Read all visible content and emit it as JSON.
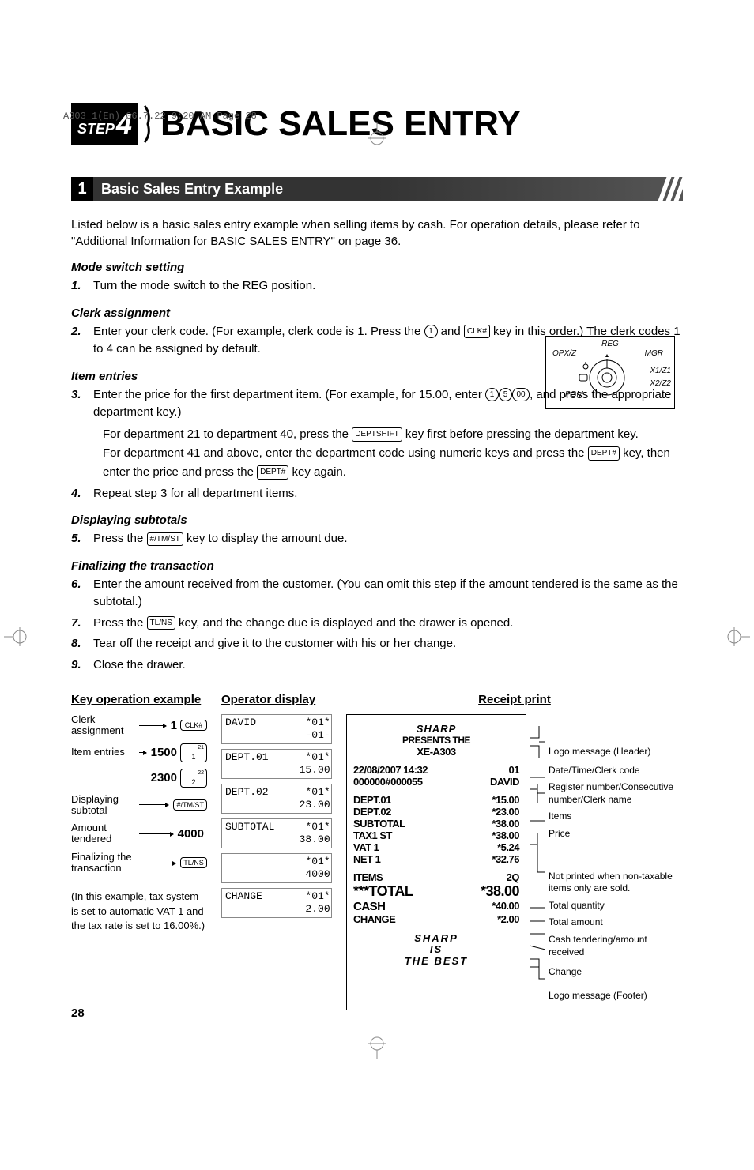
{
  "print_header": "A303_1(En)  06.7.22 9:20 AM  Page 28",
  "step_label": "STEP",
  "step_num": "4",
  "main_title": "BASIC SALES ENTRY",
  "section_num": "1",
  "section_title": "Basic Sales Entry Example",
  "intro": "Listed below is a basic sales entry example when selling items by cash.  For operation details, please refer to \"Additional Information for BASIC SALES ENTRY\" on page 36.",
  "mode_h": "Mode switch setting",
  "mode_step": "Turn the mode switch to the REG position.",
  "clerk_h": "Clerk assignment",
  "clerk_step_a": "Enter your clerk code. (For example, clerk code is 1.  Press the ",
  "clerk_step_b": " and ",
  "clerk_step_c": " key in this order.)  The clerk codes 1 to 4 can be assigned by default.",
  "clerk_key1": "1",
  "clerk_key2": "CLK#",
  "item_h": "Item entries",
  "item_step3_a": "Enter the price for the first department item. (For example, for 15.00, enter ",
  "item_step3_b": ", and press the appropriate department key.)",
  "k1": "1",
  "k5": "5",
  "k00": "00",
  "item_sub1_a": "For department 21 to department 40, press the ",
  "item_sub1_b": " key first before pressing the department key.",
  "item_sub1_key": "DEPTSHIFT",
  "item_sub2_a": "For department 41 and above, enter the department code using numeric keys and press the ",
  "item_sub2_b": " key, then enter the price and press the ",
  "item_sub2_c": " key again.",
  "item_sub2_key": "DEPT#",
  "item_step4": "Repeat step 3 for all department items.",
  "disp_h": "Displaying subtotals",
  "disp_step_a": "Press the ",
  "disp_step_b": " key to display the amount due.",
  "disp_key": "#/TM/ST",
  "fin_h": "Finalizing the transaction",
  "fin_step6": "Enter the amount received from the customer.  (You can omit this step if the amount tendered is the same as the subtotal.)",
  "fin_step7_a": "Press the ",
  "fin_step7_b": " key, and the change due is displayed and the drawer is opened.",
  "fin_key": "TL/NS",
  "fin_step8": "Tear off the receipt and give it to the customer with his or her change.",
  "fin_step9": "Close the drawer.",
  "dial": {
    "reg": "REG",
    "opxz": "OPX/Z",
    "mgr": "MGR",
    "x1z1": "X1/Z1",
    "x2z2": "X2/Z2",
    "pgm": "PGM"
  },
  "col1_h": "Key operation example",
  "col2_h": "Operator display",
  "col3_h": "Receipt print",
  "kop": [
    {
      "label": "Clerk assignment",
      "val": "1",
      "key": "CLK#"
    },
    {
      "label": "Item entries",
      "val": "1500",
      "key": "1",
      "sup": "21",
      "grouped": true
    },
    {
      "label": "",
      "val": "2300",
      "key": "2",
      "sup": "22",
      "grouped": true
    },
    {
      "label": "Displaying subtotal",
      "val": "",
      "key": "#/TM/ST"
    },
    {
      "label": "Amount tendered",
      "val": "4000",
      "key": ""
    },
    {
      "label": "Finalizing the transaction",
      "val": "",
      "key": "TL/NS"
    }
  ],
  "disp": [
    "DAVID        *01*\n             -01-",
    "DEPT.01      *01*\n            15.00",
    "DEPT.02      *01*\n            23.00",
    "SUBTOTAL     *01*\n            38.00",
    "             *01*\n             4000",
    "CHANGE       *01*\n             2.00"
  ],
  "note": "(In this example, tax system is set to automatic VAT 1 and the tax rate is set to 16.00%.)",
  "receipt": {
    "brand": "SHARP",
    "presents": "PRESENTS THE",
    "model": "XE-A303",
    "dt": "22/08/2007 14:32",
    "reg": "01",
    "consec": "000000#000055",
    "clerk": "DAVID",
    "lines": [
      {
        "l": "DEPT.01",
        "r": "*15.00"
      },
      {
        "l": "DEPT.02",
        "r": "*23.00"
      },
      {
        "l": "SUBTOTAL",
        "r": "*38.00"
      },
      {
        "l": "TAX1 ST",
        "r": "*38.00"
      },
      {
        "l": "VAT 1",
        "r": "*5.24"
      },
      {
        "l": "NET 1",
        "r": "*32.76"
      }
    ],
    "items_l": "ITEMS",
    "items_r": "2Q",
    "total_l": "***TOTAL",
    "total_r": "*38.00",
    "cash_l": "CASH",
    "cash_r": "*40.00",
    "change_l": "CHANGE",
    "change_r": "*2.00",
    "foot1": "SHARP",
    "foot2": "IS",
    "foot3": "THE BEST"
  },
  "annot": [
    "Logo message (Header)",
    "Date/Time/Clerk code",
    "Register number/Consecutive number/Clerk name",
    "Items",
    "Price",
    "Not printed when non-taxable items only are sold.",
    "Total quantity",
    "Total amount",
    "Cash tendering/amount received",
    "Change",
    "Logo message (Footer)"
  ],
  "page_num": "28"
}
